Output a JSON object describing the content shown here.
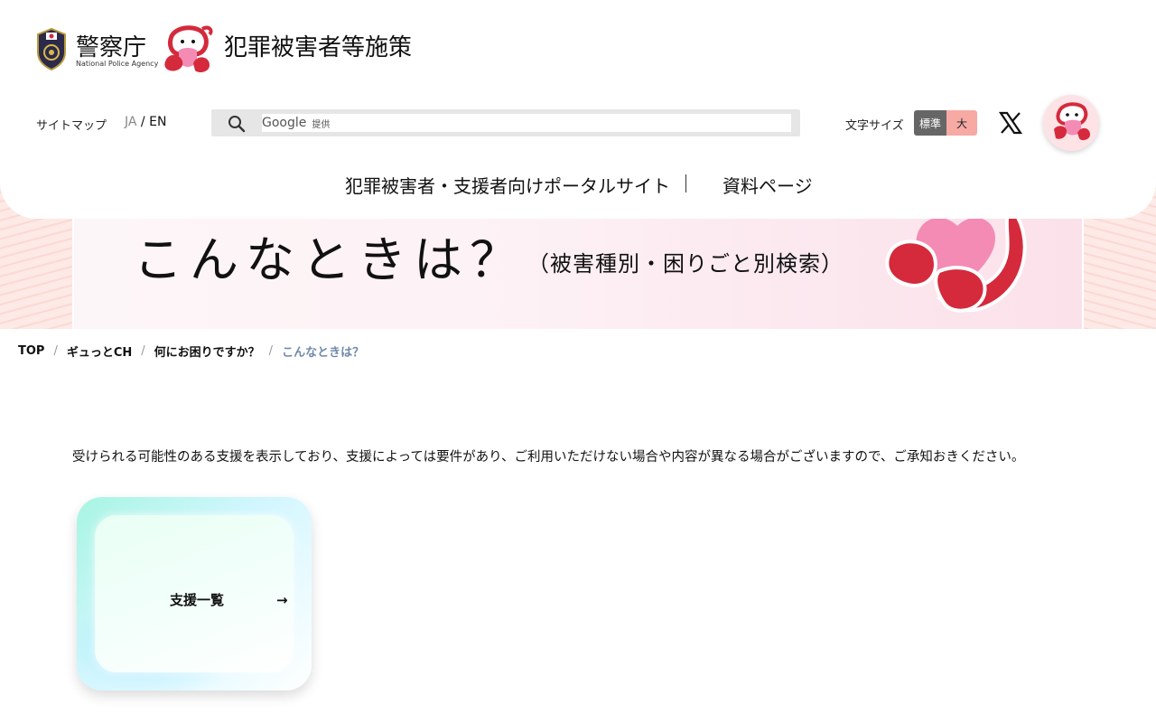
{
  "header": {
    "agency_name": "警察庁",
    "agency_name_en": "National Police Agency",
    "site_title": "犯罪被害者等施策",
    "sitemap_label": "サイトマップ",
    "lang_ja": "JA",
    "lang_sep": "/",
    "lang_en": "EN",
    "search": {
      "provider_brand": "Google",
      "provider_suffix": "提供"
    },
    "font_size_label": "文字サイズ",
    "font_size_standard": "標準",
    "font_size_large": "大",
    "nav": [
      {
        "label": "犯罪被害者・支援者向けポータルサイト"
      },
      {
        "label": "資料ページ"
      }
    ]
  },
  "hero": {
    "title": "こんなときは？",
    "subtitle": "（被害種別・困りごと別検索）"
  },
  "breadcrumb": [
    {
      "label": "TOP"
    },
    {
      "label": "ギュっとCH"
    },
    {
      "label": "何にお困りですか？"
    },
    {
      "label": "こんなときは？"
    }
  ],
  "breadcrumb_sep": "/",
  "main": {
    "notice": "受けられる可能性のある支援を表示しており、支援によっては要件があり、ご利用いただけない場合や内容が異なる場合がございますので、ご承知おきください。",
    "card": {
      "label": "支援一覧",
      "arrow": "→"
    }
  },
  "colors": {
    "accent_pink": "#f7a9a4",
    "mascot_red": "#d42a3c",
    "mascot_pink": "#f48bb4",
    "card_mint": "#a8f5e2",
    "breadcrumb_current": "#6f8aa8"
  },
  "icons": {
    "search": "search-icon",
    "x": "x-logo-icon",
    "emblem": "police-emblem-icon",
    "mascot": "mascot-icon"
  }
}
